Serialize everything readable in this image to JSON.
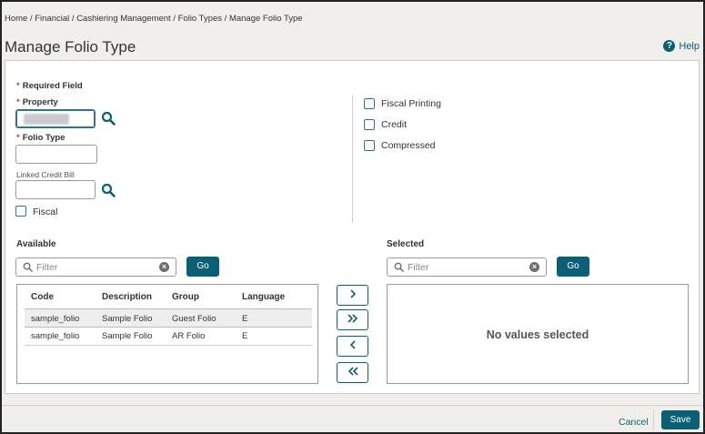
{
  "breadcrumb": "Home / Financial / Cashiering Management / Folio Types / Manage Folio Type",
  "page_title": "Manage Folio Type",
  "help_label": "Help",
  "help_icon": "?",
  "form": {
    "required_note": "Required Field",
    "required_star": "*",
    "property_label": "Property",
    "property_value": "",
    "folio_type_label": "Folio Type",
    "folio_type_value": "",
    "linked_credit_bill_label": "Linked Credit Bill",
    "linked_credit_bill_value": "",
    "fiscal_label": "Fiscal",
    "fiscal_checked": false,
    "fiscal_printing_label": "Fiscal Printing",
    "credit_label": "Credit",
    "compressed_label": "Compressed"
  },
  "available": {
    "title": "Available",
    "filter_placeholder": "Filter",
    "go_label": "Go",
    "columns": [
      "Code",
      "Description",
      "Group",
      "Language"
    ],
    "rows": [
      {
        "code": "sample_folio",
        "description": "Sample Folio",
        "group": "Guest Folio",
        "language": "E"
      },
      {
        "code": "sample_folio",
        "description": "Sample Folio",
        "group": "AR Folio",
        "language": "E"
      }
    ]
  },
  "selected": {
    "title": "Selected",
    "filter_placeholder": "Filter",
    "go_label": "Go",
    "empty_message": "No values selected"
  },
  "move_buttons": [
    "move-right-icon",
    "move-all-right-icon",
    "move-left-icon",
    "move-all-left-icon"
  ],
  "footer": {
    "cancel_label": "Cancel",
    "save_label": "Save"
  },
  "colors": {
    "accent": "#0b5f75",
    "required": "#c74634",
    "background": "#f1efec"
  }
}
